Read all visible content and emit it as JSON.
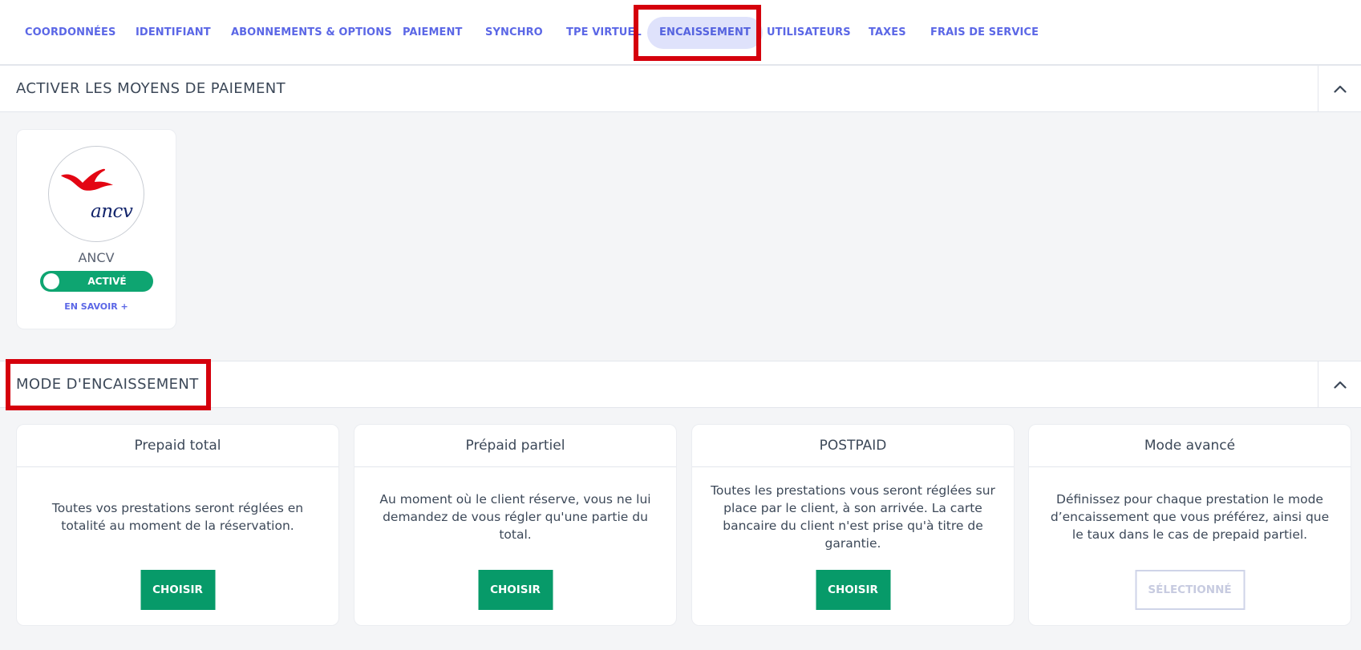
{
  "tabs": [
    {
      "label": "COORDONNÉES"
    },
    {
      "label": "IDENTIFIANT"
    },
    {
      "label": "ABONNEMENTS & OPTIONS"
    },
    {
      "label": "PAIEMENT"
    },
    {
      "label": "SYNCHRO"
    },
    {
      "label": "TPE VIRTUEL"
    },
    {
      "label": "ENCAISSEMENT",
      "active": true
    },
    {
      "label": "UTILISATEURS"
    },
    {
      "label": "TAXES"
    },
    {
      "label": "FRAIS DE SERVICE"
    }
  ],
  "payment_section": {
    "title": "ACTIVER LES MOYENS DE PAIEMENT",
    "methods": [
      {
        "logo_text": "ancv",
        "name": "ANCV",
        "toggle_label": "ACTIVÉ",
        "enabled": true,
        "learn_more": "EN SAVOIR +"
      }
    ]
  },
  "mode_section": {
    "title": "MODE D'ENCAISSEMENT",
    "modes": [
      {
        "title": "Prepaid total",
        "description": "Toutes vos prestations seront réglées en totalité au moment de la réservation.",
        "button": "CHOISIR",
        "selected": false
      },
      {
        "title": "Prépaid partiel",
        "description": "Au moment où le client réserve, vous ne lui demandez de vous régler qu'une partie du total.",
        "button": "CHOISIR",
        "selected": false
      },
      {
        "title": "POSTPAID",
        "description": "Toutes les prestations vous seront réglées sur place par le client, à son arrivée. La carte bancaire du client n'est prise qu'à titre de garantie.",
        "button": "CHOISIR",
        "selected": false
      },
      {
        "title": "Mode avancé",
        "description": "Définissez pour chaque prestation le mode d’encaissement que vous préférez, ainsi que le taux dans le cas de prepaid partiel.",
        "button": "SÉLECTIONNÉ",
        "selected": true
      }
    ]
  },
  "colors": {
    "accent": "#5b67e6",
    "active_tab_bg": "#dfe2fb",
    "primary_button": "#079a69",
    "toggle_on": "#0ea571",
    "highlight": "#d5000c"
  }
}
